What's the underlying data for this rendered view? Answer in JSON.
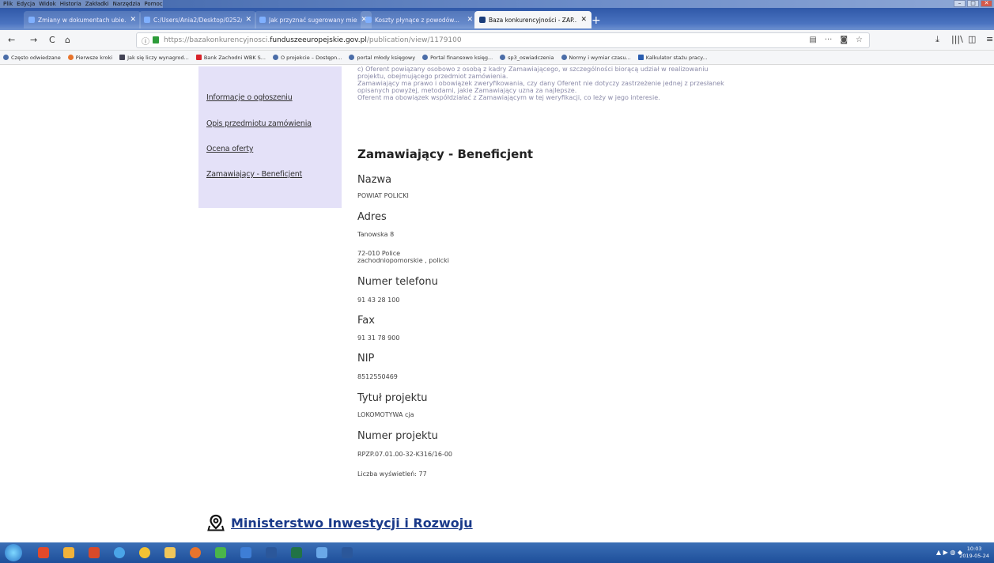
{
  "window": {
    "menu": [
      "Plik",
      "Edycja",
      "Widok",
      "Historia",
      "Zakładki",
      "Narzędzia",
      "Pomoc"
    ],
    "controls": [
      "–",
      "□",
      "✕"
    ]
  },
  "tabs": [
    {
      "title": "Zmiany w dokumentach ubie...",
      "close": "✕"
    },
    {
      "title": "C:/Users/Ania2/Desktop/0252/...",
      "close": "✕"
    },
    {
      "title": "Jak przyznać sugerowany mies...",
      "close": "✕"
    },
    {
      "title": "Koszty płynące z powodów...",
      "close": "✕"
    },
    {
      "title": "Baza konkurencyjności - ZAP...",
      "close": "✕",
      "active": true
    }
  ],
  "nav": {
    "back": "←",
    "forward": "→",
    "reload": "C",
    "home": "⌂",
    "url_prefix": "https://bazakonkurencyjnosci.",
    "url_domain": "funduszeeuropejskie.gov.pl",
    "url_suffix": "/publication/view/1179100",
    "reader": "▤",
    "more": "···",
    "pocket": "◙",
    "star": "☆",
    "download": "⤓",
    "library": "|||\\",
    "sidebar": "◫",
    "menu": "≡"
  },
  "bookmarks": [
    "Często odwiedzane",
    "Pierwsze kroki",
    "Jak się liczy wynagrod...",
    "Bank Zachodni WBK S...",
    "O projekcie – Dostępn...",
    "portal młody księgowy",
    "Portal finansowo księg...",
    "sp3_oswiadczenia",
    "Normy i wymiar czasu...",
    "Kalkulator stażu pracy..."
  ],
  "sidenav": [
    "Informacje o ogłoszeniu",
    "Opis przedmiotu zamówienia",
    "Ocena oferty",
    "Zamawiający - Beneficjent"
  ],
  "intro": [
    "c) Oferent powiązany osobowo z osobą z kadry Zamawiającego, w szczególności biorącą udział w realizowaniu",
    "projektu, obejmującego przedmiot zamówienia.",
    "Zamawiający ma prawo i obowiązek zweryfikowania, czy dany Oferent nie dotyczy zastrzeżenie jednej z przesłanek",
    "opisanych powyżej, metodami, jakie Zamawiający uzna za najlepsze.",
    "Oferent ma obowiązek współdziałać z Zamawiającym w tej weryfikacji, co leży w jego interesie."
  ],
  "section": {
    "heading": "Zamawiający - Beneficjent",
    "name_label": "Nazwa",
    "name": "POWIAT POLICKI",
    "address_label": "Adres",
    "street": "Tanowska 8",
    "city": "72-010 Police",
    "region": "zachodniopomorskie , policki",
    "phone_label": "Numer telefonu",
    "phone": "91 43 28 100",
    "fax_label": "Fax",
    "fax": "91 31 78 900",
    "nip_label": "NIP",
    "nip": "8512550469",
    "title_label": "Tytuł projektu",
    "title": "LOKOMOTYWA cja",
    "number_label": "Numer projektu",
    "number": "RPZP.07.01.00-32-K316/16-00",
    "views": "Liczba wyświetleń: 77"
  },
  "footer": {
    "ministry": "Ministerstwo Inwestycji i Rozwoju"
  },
  "taskbar": {
    "tray": "▲ ▶ ◍ ◆",
    "time": "10:03",
    "date": "2019-05-24"
  }
}
